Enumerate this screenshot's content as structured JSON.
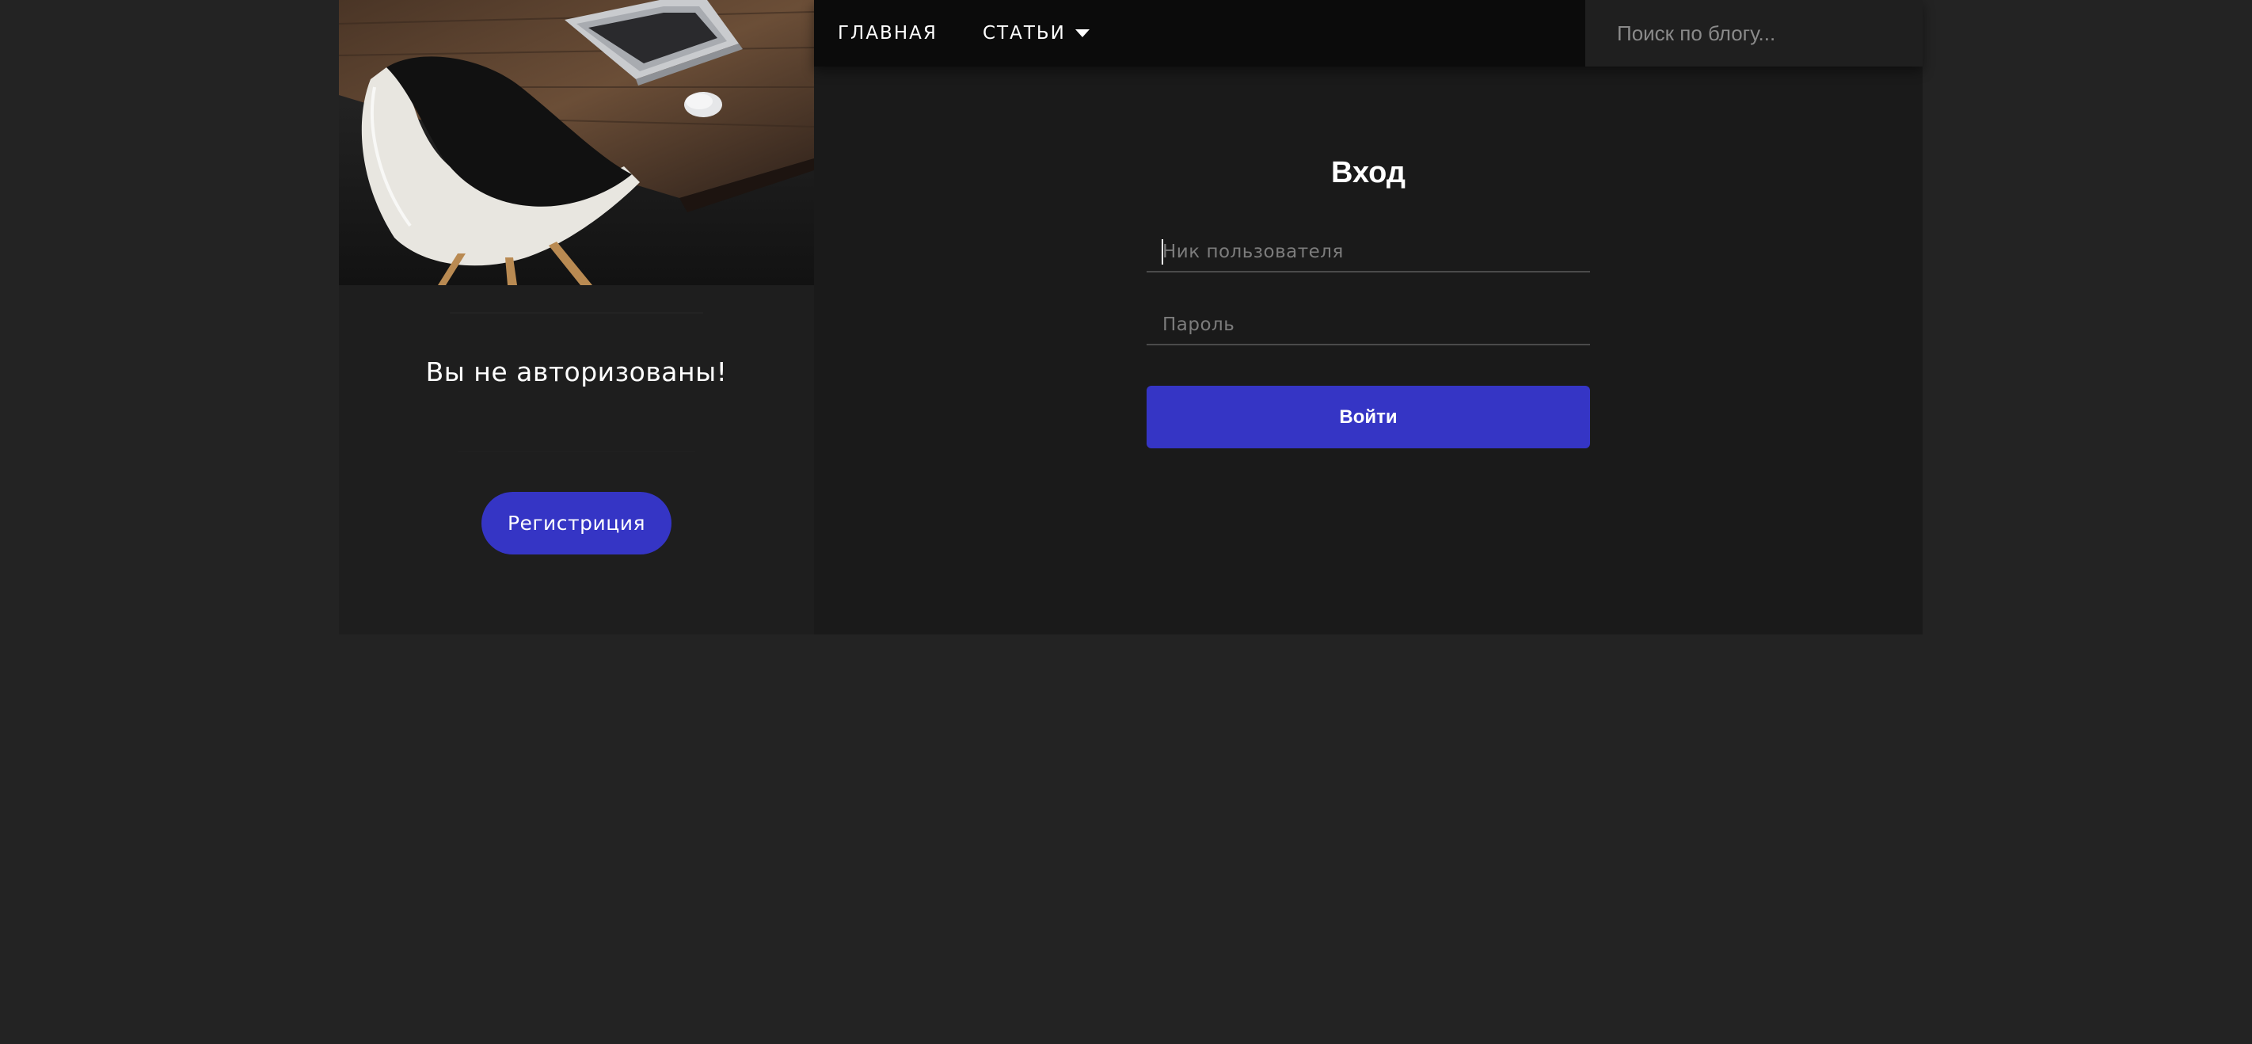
{
  "nav": {
    "home_label": "ГЛАВНАЯ",
    "articles_label": "СТАТЬИ",
    "articles_icon": "caret-down-icon",
    "search_placeholder": "Поиск по блогу..."
  },
  "sidebar": {
    "hero_image": "desk-laptop-chair-photo",
    "status_text": "Вы не авторизованы!",
    "register_label": "Регистриция"
  },
  "login": {
    "title": "Вход",
    "username_placeholder": "Ник пользователя",
    "username_value": "",
    "password_placeholder": "Пароль",
    "password_value": "",
    "submit_label": "Войти"
  },
  "colors": {
    "accent": "#3535c5",
    "background": "#232323",
    "panel": "#1a1a1a",
    "navbar": "#0b0b0b"
  }
}
